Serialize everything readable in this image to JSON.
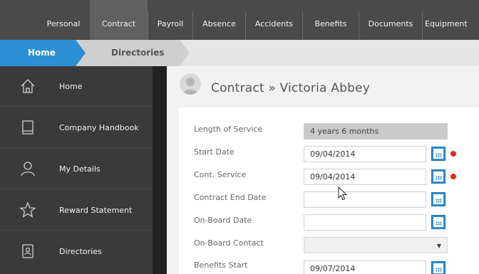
{
  "top_tabs": [
    "Personal",
    "Contract",
    "Payroll",
    "Absence",
    "Accidents",
    "Benefits",
    "Documents",
    "Equipment"
  ],
  "active_tab": "Contract",
  "breadcrumb": {
    "home": "Home",
    "current": "Directories"
  },
  "sidebar": {
    "items": [
      {
        "label": "Home",
        "icon": "home-icon"
      },
      {
        "label": "Company Handbook",
        "icon": "book-icon"
      },
      {
        "label": "My Details",
        "icon": "user-icon"
      },
      {
        "label": "Reward Statement",
        "icon": "star-icon"
      },
      {
        "label": "Directories",
        "icon": "contact-card-icon"
      }
    ]
  },
  "page": {
    "title": "Contract » Victoria Abbey"
  },
  "form": {
    "length_of_service": {
      "label": "Length of Service",
      "value": "4 years 6 months"
    },
    "start_date": {
      "label": "Start Date",
      "value": "09/04/2014"
    },
    "cont_service": {
      "label": "Cont. Service",
      "value": "09/04/2014"
    },
    "contract_end_date": {
      "label": "Contract End Date",
      "value": ""
    },
    "onboard_date": {
      "label": "On-Board Date",
      "value": ""
    },
    "onboard_contact": {
      "label": "On-Board Contact",
      "value": ""
    },
    "benefits_start": {
      "label": "Benefits Start",
      "value": "09/07/2014"
    }
  },
  "colors": {
    "accent": "#2b8fd1",
    "required": "#e8281e",
    "topbar": "#4a4a4a",
    "sidebar": "#3a3a3a"
  }
}
